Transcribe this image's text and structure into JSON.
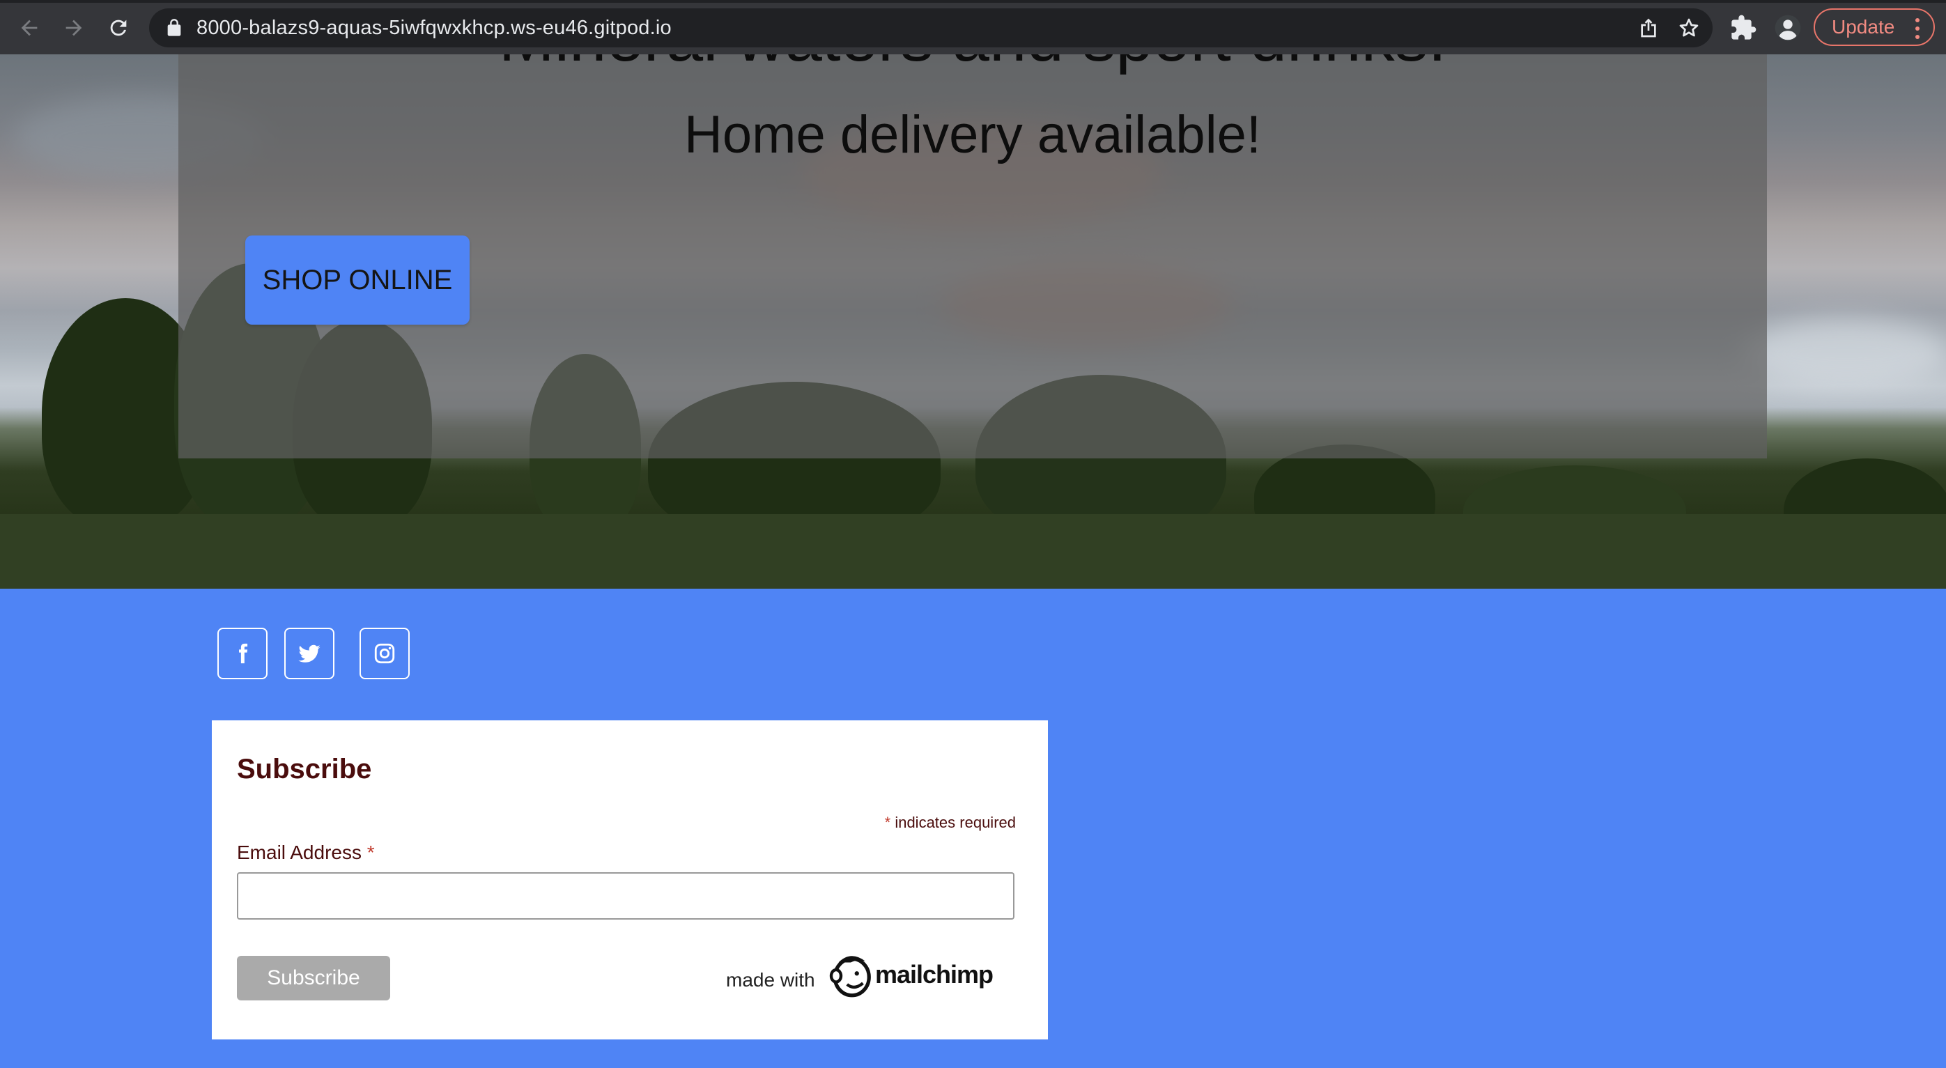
{
  "browser": {
    "url": "8000-balazs9-aquas-5iwfqwxkhcp.ws-eu46.gitpod.io",
    "update_label": "Update",
    "icons": [
      "back-icon",
      "forward-icon",
      "reload-icon",
      "lock-icon",
      "share-icon",
      "star-icon",
      "extensions-icon",
      "profile-icon",
      "kebab-menu-icon"
    ]
  },
  "hero": {
    "title": "Mineral waters and sport drinks!",
    "subtitle": "Home delivery available!",
    "shop_button": "SHOP ONLINE"
  },
  "social": {
    "items": [
      "facebook-icon",
      "twitter-icon",
      "instagram-icon"
    ]
  },
  "subscribe_form": {
    "title": "Subscribe",
    "required_star": "*",
    "required_note": "indicates required",
    "email_label": "Email Address",
    "email_value": "",
    "submit_label": "Subscribe",
    "made_with": "made with",
    "brand": "mailchimp"
  },
  "colors": {
    "accent_blue": "#4f84f5",
    "form_text": "#4a0c0c",
    "required_star": "#c0392b",
    "update_button": "#f28b82"
  }
}
